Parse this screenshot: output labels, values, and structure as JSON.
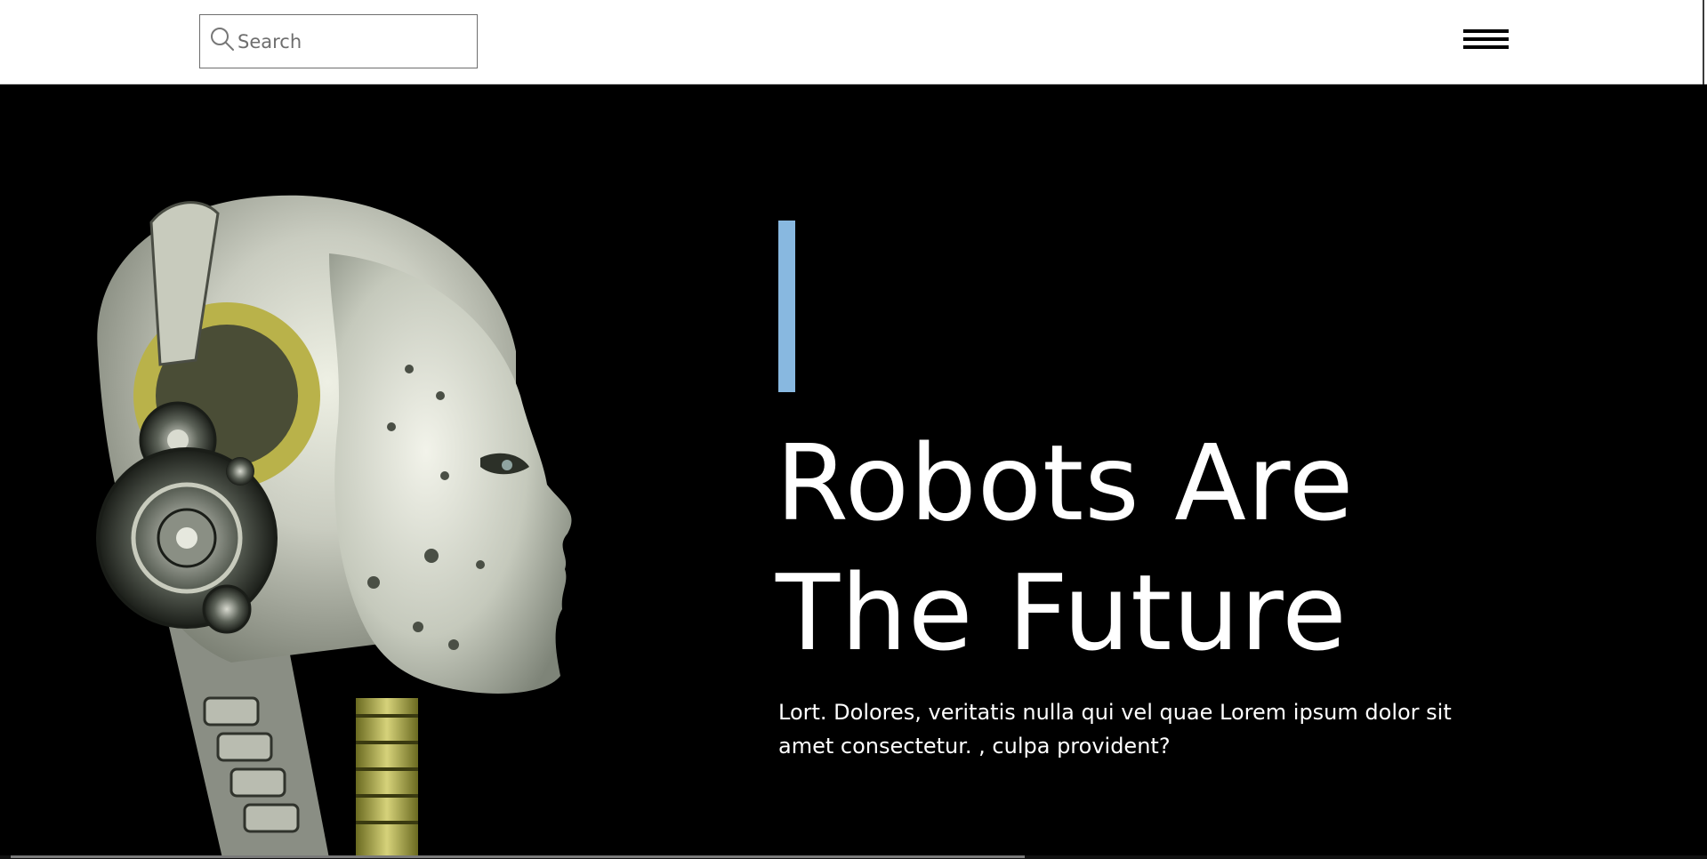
{
  "header": {
    "search": {
      "placeholder": "Search",
      "value": "",
      "icon": "search-icon"
    },
    "menu_icon": "hamburger-menu-icon"
  },
  "hero": {
    "image": "robot-head-image",
    "accent_color": "#88b8e0",
    "headline_line1": "Robots Are",
    "headline_line2": "The Future",
    "description": "Lort. Dolores, veritatis nulla qui vel quae Lorem ipsum dolor sit amet consectetur. , culpa provident?"
  },
  "colors": {
    "header_bg": "#ffffff",
    "hero_bg": "#000000",
    "text": "#ffffff",
    "accent": "#88b8e0"
  }
}
